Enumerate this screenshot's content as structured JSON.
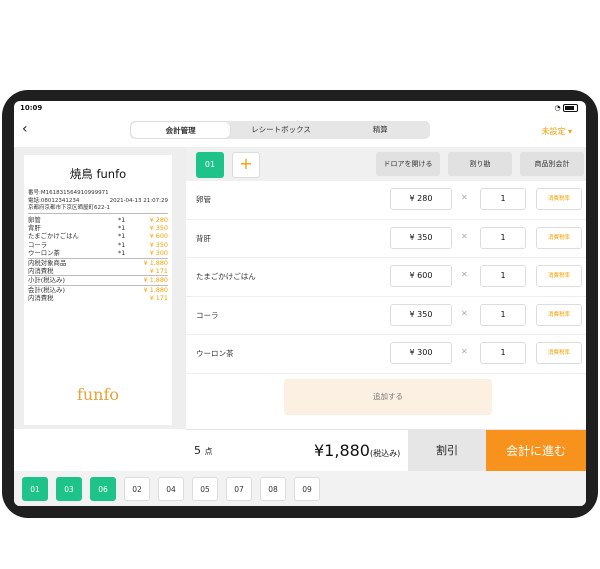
{
  "status": {
    "time": "10:09"
  },
  "header": {
    "segments": [
      {
        "label": "会計管理",
        "active": true
      },
      {
        "label": "レシートボックス",
        "active": false
      },
      {
        "label": "精算",
        "active": false
      }
    ],
    "unset_label": "未設定"
  },
  "receipt": {
    "title": "焼鳥 funfo",
    "number": "番号:M161831564910999971",
    "phone": "電話:08012341234",
    "datetime": "2021-04-13 21:07:29",
    "address": "京都府京都市下京区晒屋町622-1",
    "lines": [
      {
        "name": "卵管",
        "qty": "*1",
        "price": "¥ 280"
      },
      {
        "name": "背肝",
        "qty": "*1",
        "price": "¥ 350"
      },
      {
        "name": "たまごかけごはん",
        "qty": "*1",
        "price": "¥ 600"
      },
      {
        "name": "コーラ",
        "qty": "*1",
        "price": "¥ 350"
      },
      {
        "name": "ウーロン茶",
        "qty": "*1",
        "price": "¥ 300"
      }
    ],
    "summary": [
      {
        "name": "内税対象商品",
        "price": "¥ 1,880"
      },
      {
        "name": "内消費税",
        "price": "¥ 171"
      },
      {
        "name": "小計(税込み)",
        "price": "¥ 1,880"
      },
      {
        "name": "会計(税込み)",
        "price": "¥ 1,880"
      },
      {
        "name": "内消費税",
        "price": "¥ 171"
      }
    ],
    "logo": "funfo"
  },
  "toolbar": {
    "tab": "01",
    "drawer": "ドロアを開ける",
    "split": "割り勘",
    "by_product": "商品別会計"
  },
  "items": [
    {
      "name": "卵管",
      "price": "¥ 280",
      "qty": "1",
      "tax": "消費税率"
    },
    {
      "name": "背肝",
      "price": "¥ 350",
      "qty": "1",
      "tax": "消費税率"
    },
    {
      "name": "たまごかけごはん",
      "price": "¥ 600",
      "qty": "1",
      "tax": "消費税率"
    },
    {
      "name": "コーラ",
      "price": "¥ 350",
      "qty": "1",
      "tax": "消費税率"
    },
    {
      "name": "ウーロン茶",
      "price": "¥ 300",
      "qty": "1",
      "tax": "消費税率"
    }
  ],
  "add_label": "追加する",
  "footer": {
    "count": "5",
    "count_unit": "点",
    "total": "¥1,880",
    "total_suffix": "(税込み)",
    "discount": "割引",
    "proceed": "会計に進む"
  },
  "bottom_tabs": [
    {
      "label": "01",
      "on": true
    },
    {
      "label": "03",
      "on": true
    },
    {
      "label": "06",
      "on": true
    },
    {
      "label": "02",
      "on": false
    },
    {
      "label": "04",
      "on": false
    },
    {
      "label": "05",
      "on": false
    },
    {
      "label": "07",
      "on": false
    },
    {
      "label": "08",
      "on": false
    },
    {
      "label": "09",
      "on": false
    }
  ],
  "colors": {
    "accent": "#1ec38a",
    "orange": "#f7931d"
  }
}
